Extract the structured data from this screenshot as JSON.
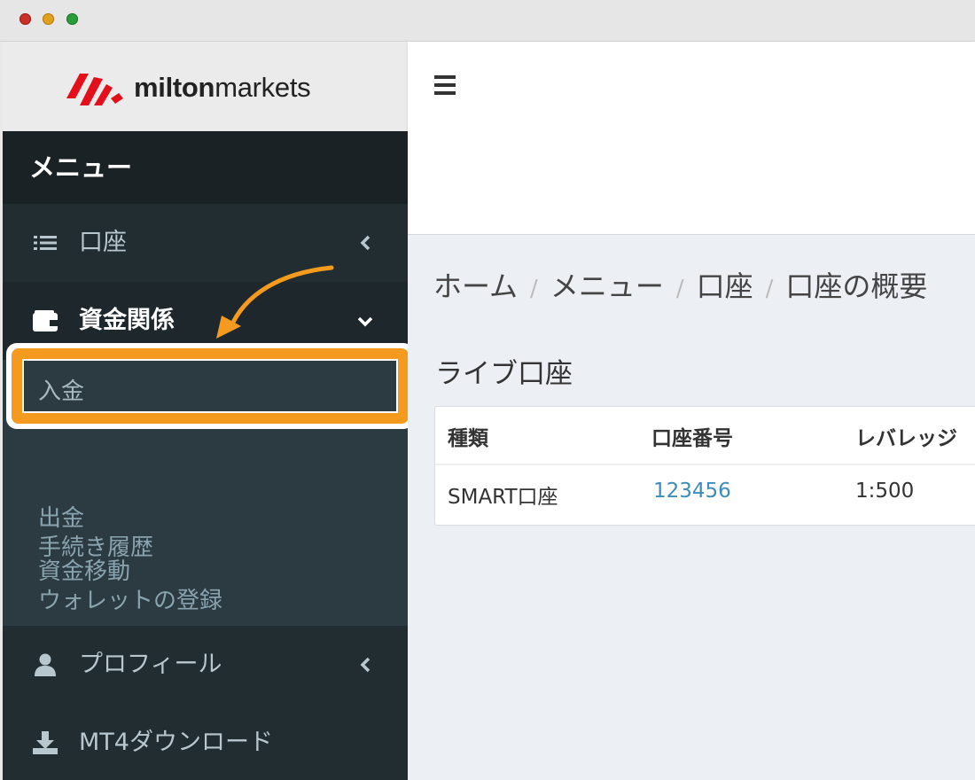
{
  "brand": {
    "logo_text_bold": "milton",
    "logo_text_regular": "markets"
  },
  "colors": {
    "sidebar_bg": "#222d32",
    "submenu_bg": "#2c3b41",
    "highlight": "#f39a1f",
    "link": "#3c8dbc"
  },
  "topbar": {
    "menu_icon": "hamburger-icon"
  },
  "sidebar": {
    "header": "メニュー",
    "items": [
      {
        "label": "口座",
        "icon": "list-icon",
        "expanded": false
      },
      {
        "label": "資金関係",
        "icon": "wallet-icon",
        "expanded": true,
        "sub_items": [
          "入金",
          "出金",
          "資金移動",
          "手続き履歴",
          "ウォレットの登録"
        ]
      },
      {
        "label": "プロフィール",
        "icon": "user-icon",
        "expanded": false
      },
      {
        "label": "MT4ダウンロード",
        "icon": "download-icon"
      }
    ]
  },
  "breadcrumb": [
    "ホーム",
    "メニュー",
    "口座",
    "口座の概要"
  ],
  "section_title": "ライブ口座",
  "table": {
    "headers": [
      "種類",
      "口座番号",
      "レバレッジ"
    ],
    "rows": [
      [
        "SMART口座",
        "123456",
        "1:500"
      ]
    ]
  }
}
